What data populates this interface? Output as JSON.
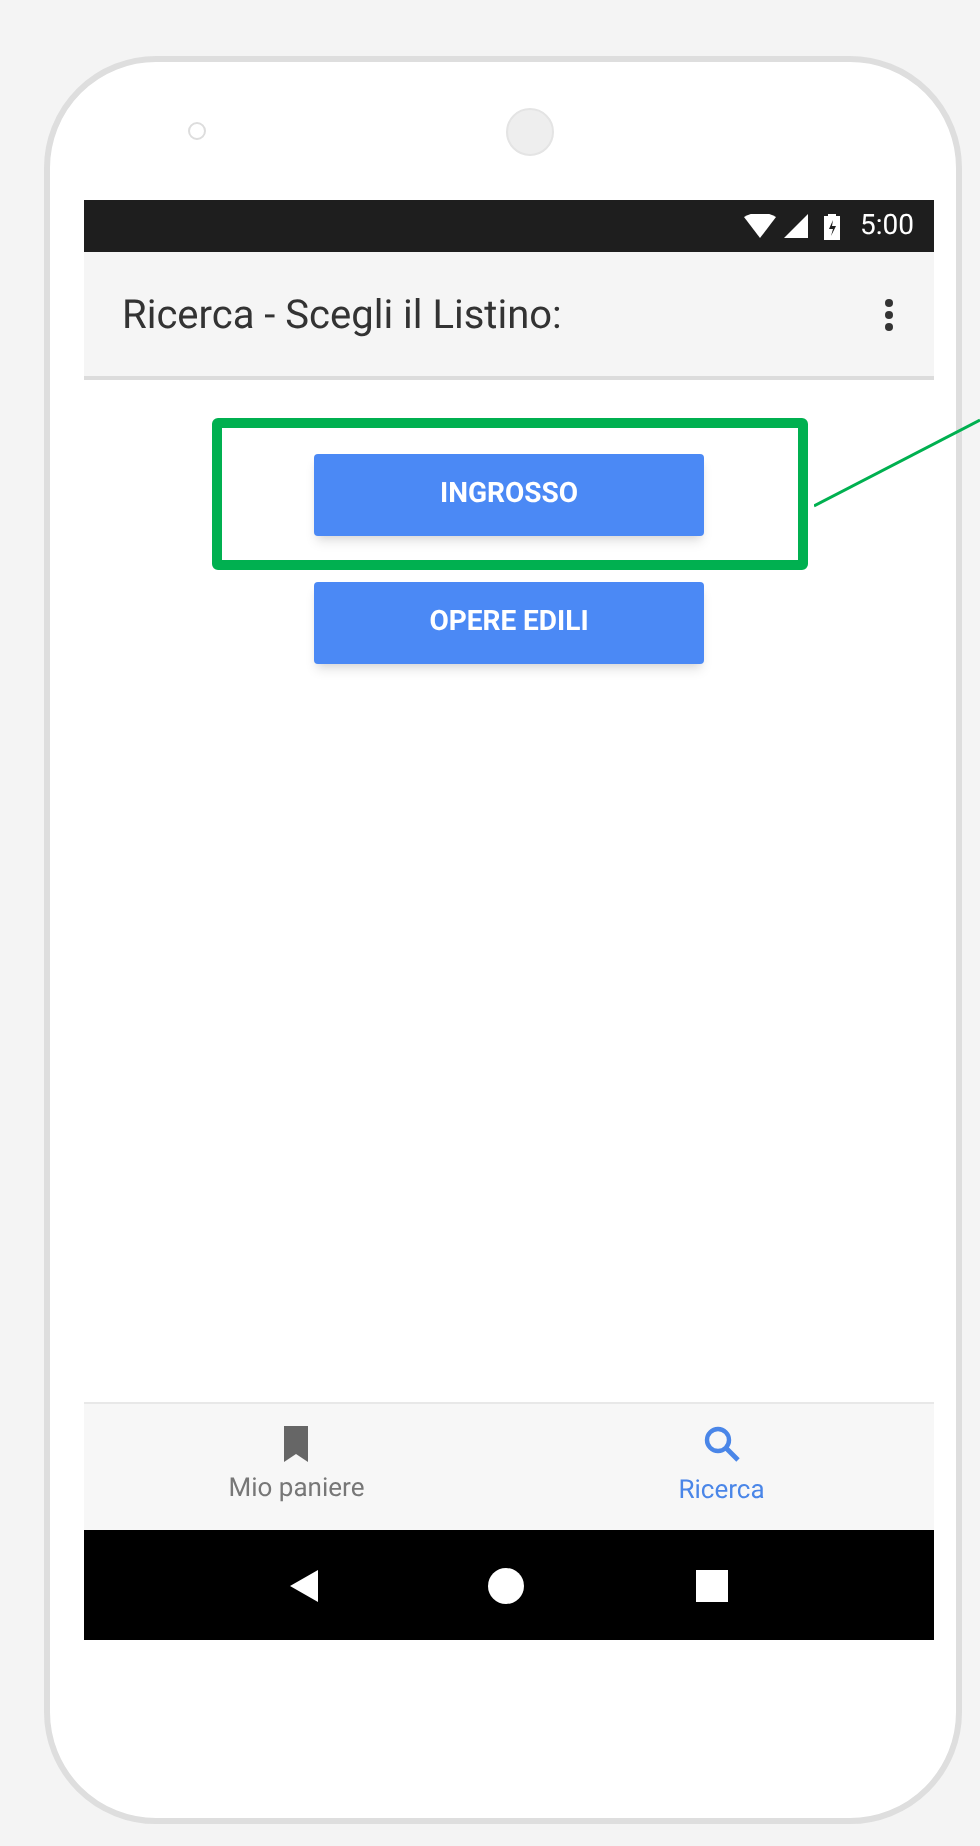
{
  "status_bar": {
    "time": "5:00"
  },
  "app_bar": {
    "title": "Ricerca - Scegli il Listino:"
  },
  "buttons": [
    {
      "label": "INGROSSO",
      "highlighted": true
    },
    {
      "label": "OPERE EDILI",
      "highlighted": false
    }
  ],
  "bottom_nav": [
    {
      "label": "Mio paniere",
      "kind": "bookmark",
      "selected": false
    },
    {
      "label": "Ricerca",
      "kind": "search",
      "selected": true
    }
  ]
}
